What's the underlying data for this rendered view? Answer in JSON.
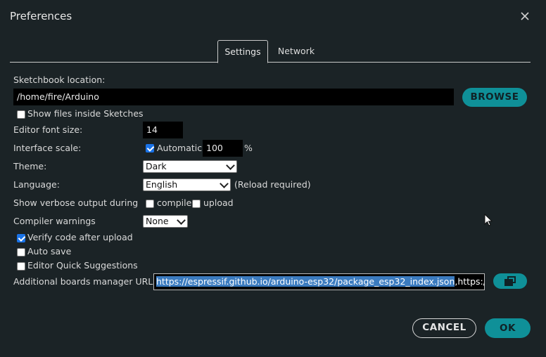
{
  "window": {
    "title": "Preferences"
  },
  "tabs": [
    {
      "label": "Settings",
      "active": true
    },
    {
      "label": "Network",
      "active": false
    }
  ],
  "sketchbook": {
    "label": "Sketchbook location:",
    "value": "/home/fire/Arduino",
    "browse_label": "BROWSE",
    "show_files_label": "Show files inside Sketches",
    "show_files_checked": false
  },
  "font_size": {
    "label": "Editor font size:",
    "value": "14"
  },
  "interface_scale": {
    "label": "Interface scale:",
    "automatic_label": "Automatic",
    "automatic_checked": true,
    "value": "100",
    "unit": "%"
  },
  "theme": {
    "label": "Theme:",
    "selected": "Dark"
  },
  "language": {
    "label": "Language:",
    "selected": "English",
    "note": "(Reload required)"
  },
  "verbose": {
    "label": "Show verbose output during",
    "compile_label": "compile",
    "compile_checked": false,
    "upload_label": "upload",
    "upload_checked": false
  },
  "compiler_warnings": {
    "label": "Compiler warnings",
    "selected": "None"
  },
  "options": {
    "verify_label": "Verify code after upload",
    "verify_checked": true,
    "autosave_label": "Auto save",
    "autosave_checked": false,
    "quick_suggestions_label": "Editor Quick Suggestions",
    "quick_suggestions_checked": false
  },
  "boards_urls": {
    "label": "Additional boards manager URLs:",
    "selected_part": "https://espressif.github.io/arduino-esp32/package_esp32_index.json",
    "rest_part": ",https://ra"
  },
  "footer": {
    "cancel_label": "CANCEL",
    "ok_label": "OK"
  },
  "colors": {
    "background": "#1b2326",
    "accent": "#0f9098",
    "selection": "#3b7bbf"
  }
}
